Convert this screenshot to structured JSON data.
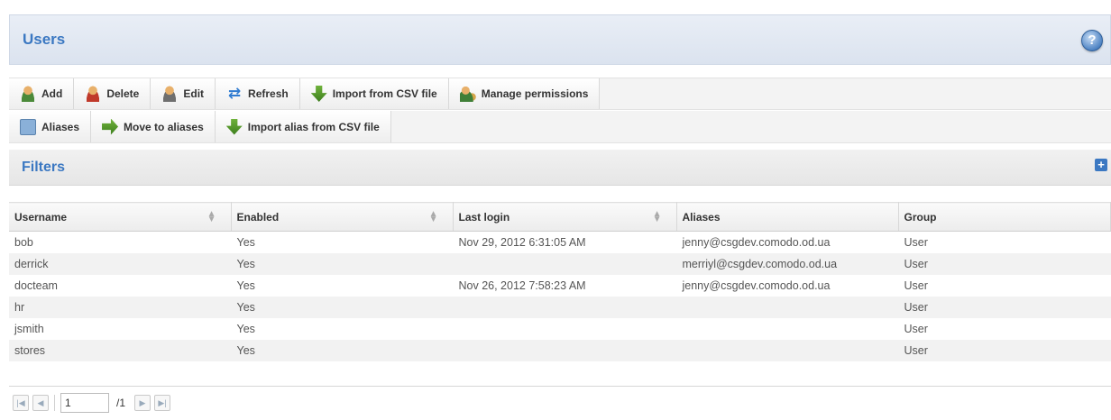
{
  "header": {
    "title": "Users"
  },
  "toolbar": {
    "row1": [
      {
        "label": "Add",
        "icon": "user-add-icon"
      },
      {
        "label": "Delete",
        "icon": "user-delete-icon"
      },
      {
        "label": "Edit",
        "icon": "user-edit-icon"
      },
      {
        "label": "Refresh",
        "icon": "refresh-icon"
      },
      {
        "label": "Import from CSV file",
        "icon": "import-icon"
      },
      {
        "label": "Manage permissions",
        "icon": "permissions-icon"
      }
    ],
    "row2": [
      {
        "label": "Aliases",
        "icon": "aliases-icon"
      },
      {
        "label": "Move to aliases",
        "icon": "move-icon"
      },
      {
        "label": "Import alias from CSV file",
        "icon": "import-icon"
      }
    ]
  },
  "filters": {
    "label": "Filters"
  },
  "table": {
    "columns": [
      "Username",
      "Enabled",
      "Last login",
      "Aliases",
      "Group"
    ],
    "rows": [
      [
        "bob",
        "Yes",
        "Nov 29, 2012 6:31:05 AM",
        "jenny@csgdev.comodo.od.ua",
        "User"
      ],
      [
        "derrick",
        "Yes",
        "",
        "merriyl@csgdev.comodo.od.ua",
        "User"
      ],
      [
        "docteam",
        "Yes",
        "Nov 26, 2012 7:58:23 AM",
        "jenny@csgdev.comodo.od.ua",
        "User"
      ],
      [
        "hr",
        "Yes",
        "",
        "",
        "User"
      ],
      [
        "jsmith",
        "Yes",
        "",
        "",
        "User"
      ],
      [
        "stores",
        "Yes",
        "",
        "",
        "User"
      ]
    ]
  },
  "pager": {
    "page": "1",
    "total": "/1"
  }
}
